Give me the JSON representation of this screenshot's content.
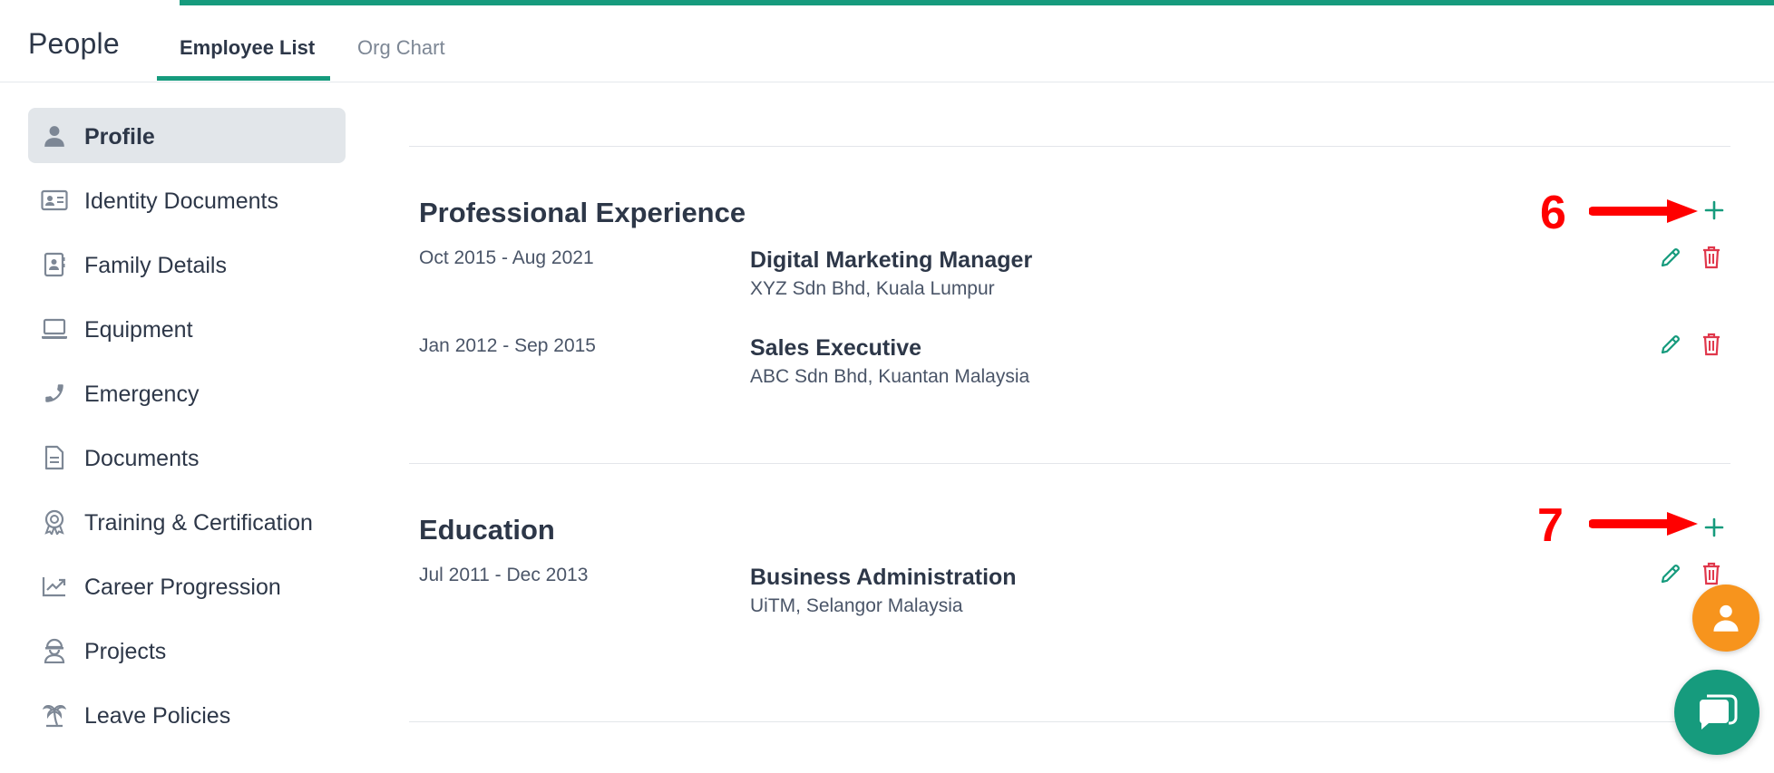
{
  "app": {
    "title": "People"
  },
  "tabs": [
    {
      "label": "Employee List",
      "active": true
    },
    {
      "label": "Org Chart",
      "active": false
    }
  ],
  "sidebar": {
    "items": [
      {
        "label": "Profile",
        "icon": "user-icon",
        "active": true
      },
      {
        "label": "Identity Documents",
        "icon": "id-card-icon"
      },
      {
        "label": "Family Details",
        "icon": "contact-book-icon"
      },
      {
        "label": "Equipment",
        "icon": "laptop-icon"
      },
      {
        "label": "Emergency",
        "icon": "phone-icon"
      },
      {
        "label": "Documents",
        "icon": "document-icon"
      },
      {
        "label": "Training & Certification",
        "icon": "award-icon"
      },
      {
        "label": "Career Progression",
        "icon": "chart-line-icon"
      },
      {
        "label": "Projects",
        "icon": "worker-icon"
      },
      {
        "label": "Leave Policies",
        "icon": "palm-tree-icon"
      }
    ]
  },
  "experience": {
    "title": "Professional Experience",
    "entries": [
      {
        "dates": "Oct 2015 - Aug 2021",
        "title": "Digital Marketing Manager",
        "sub": "XYZ Sdn Bhd, Kuala Lumpur"
      },
      {
        "dates": "Jan 2012 - Sep 2015",
        "title": "Sales Executive",
        "sub": "ABC Sdn Bhd, Kuantan Malaysia"
      }
    ]
  },
  "education": {
    "title": "Education",
    "entries": [
      {
        "dates": "Jul 2011 - Dec 2013",
        "title": "Business Administration",
        "sub": "UiTM, Selangor Malaysia"
      }
    ]
  },
  "annotations": {
    "step_experience": "6",
    "step_education": "7"
  },
  "colors": {
    "accent": "#169b7d",
    "danger": "#e0384c",
    "annotation": "#ff0000",
    "fab": "#f7941d"
  }
}
